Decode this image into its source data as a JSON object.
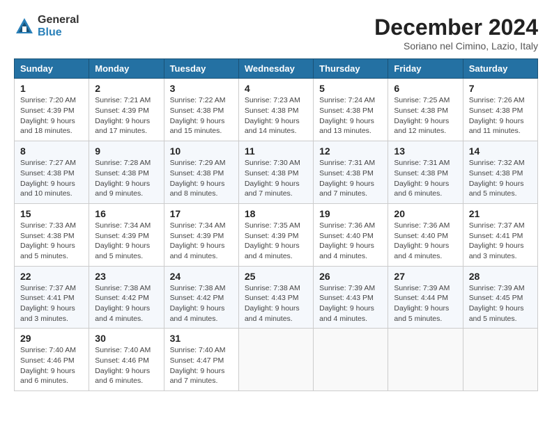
{
  "logo": {
    "general": "General",
    "blue": "Blue"
  },
  "title": "December 2024",
  "subtitle": "Soriano nel Cimino, Lazio, Italy",
  "days_of_week": [
    "Sunday",
    "Monday",
    "Tuesday",
    "Wednesday",
    "Thursday",
    "Friday",
    "Saturday"
  ],
  "weeks": [
    [
      {
        "day": "1",
        "sunrise": "7:20 AM",
        "sunset": "4:39 PM",
        "daylight": "9 hours and 18 minutes."
      },
      {
        "day": "2",
        "sunrise": "7:21 AM",
        "sunset": "4:39 PM",
        "daylight": "9 hours and 17 minutes."
      },
      {
        "day": "3",
        "sunrise": "7:22 AM",
        "sunset": "4:38 PM",
        "daylight": "9 hours and 15 minutes."
      },
      {
        "day": "4",
        "sunrise": "7:23 AM",
        "sunset": "4:38 PM",
        "daylight": "9 hours and 14 minutes."
      },
      {
        "day": "5",
        "sunrise": "7:24 AM",
        "sunset": "4:38 PM",
        "daylight": "9 hours and 13 minutes."
      },
      {
        "day": "6",
        "sunrise": "7:25 AM",
        "sunset": "4:38 PM",
        "daylight": "9 hours and 12 minutes."
      },
      {
        "day": "7",
        "sunrise": "7:26 AM",
        "sunset": "4:38 PM",
        "daylight": "9 hours and 11 minutes."
      }
    ],
    [
      {
        "day": "8",
        "sunrise": "7:27 AM",
        "sunset": "4:38 PM",
        "daylight": "9 hours and 10 minutes."
      },
      {
        "day": "9",
        "sunrise": "7:28 AM",
        "sunset": "4:38 PM",
        "daylight": "9 hours and 9 minutes."
      },
      {
        "day": "10",
        "sunrise": "7:29 AM",
        "sunset": "4:38 PM",
        "daylight": "9 hours and 8 minutes."
      },
      {
        "day": "11",
        "sunrise": "7:30 AM",
        "sunset": "4:38 PM",
        "daylight": "9 hours and 7 minutes."
      },
      {
        "day": "12",
        "sunrise": "7:31 AM",
        "sunset": "4:38 PM",
        "daylight": "9 hours and 7 minutes."
      },
      {
        "day": "13",
        "sunrise": "7:31 AM",
        "sunset": "4:38 PM",
        "daylight": "9 hours and 6 minutes."
      },
      {
        "day": "14",
        "sunrise": "7:32 AM",
        "sunset": "4:38 PM",
        "daylight": "9 hours and 5 minutes."
      }
    ],
    [
      {
        "day": "15",
        "sunrise": "7:33 AM",
        "sunset": "4:38 PM",
        "daylight": "9 hours and 5 minutes."
      },
      {
        "day": "16",
        "sunrise": "7:34 AM",
        "sunset": "4:39 PM",
        "daylight": "9 hours and 5 minutes."
      },
      {
        "day": "17",
        "sunrise": "7:34 AM",
        "sunset": "4:39 PM",
        "daylight": "9 hours and 4 minutes."
      },
      {
        "day": "18",
        "sunrise": "7:35 AM",
        "sunset": "4:39 PM",
        "daylight": "9 hours and 4 minutes."
      },
      {
        "day": "19",
        "sunrise": "7:36 AM",
        "sunset": "4:40 PM",
        "daylight": "9 hours and 4 minutes."
      },
      {
        "day": "20",
        "sunrise": "7:36 AM",
        "sunset": "4:40 PM",
        "daylight": "9 hours and 4 minutes."
      },
      {
        "day": "21",
        "sunrise": "7:37 AM",
        "sunset": "4:41 PM",
        "daylight": "9 hours and 3 minutes."
      }
    ],
    [
      {
        "day": "22",
        "sunrise": "7:37 AM",
        "sunset": "4:41 PM",
        "daylight": "9 hours and 3 minutes."
      },
      {
        "day": "23",
        "sunrise": "7:38 AM",
        "sunset": "4:42 PM",
        "daylight": "9 hours and 4 minutes."
      },
      {
        "day": "24",
        "sunrise": "7:38 AM",
        "sunset": "4:42 PM",
        "daylight": "9 hours and 4 minutes."
      },
      {
        "day": "25",
        "sunrise": "7:38 AM",
        "sunset": "4:43 PM",
        "daylight": "9 hours and 4 minutes."
      },
      {
        "day": "26",
        "sunrise": "7:39 AM",
        "sunset": "4:43 PM",
        "daylight": "9 hours and 4 minutes."
      },
      {
        "day": "27",
        "sunrise": "7:39 AM",
        "sunset": "4:44 PM",
        "daylight": "9 hours and 5 minutes."
      },
      {
        "day": "28",
        "sunrise": "7:39 AM",
        "sunset": "4:45 PM",
        "daylight": "9 hours and 5 minutes."
      }
    ],
    [
      {
        "day": "29",
        "sunrise": "7:40 AM",
        "sunset": "4:46 PM",
        "daylight": "9 hours and 6 minutes."
      },
      {
        "day": "30",
        "sunrise": "7:40 AM",
        "sunset": "4:46 PM",
        "daylight": "9 hours and 6 minutes."
      },
      {
        "day": "31",
        "sunrise": "7:40 AM",
        "sunset": "4:47 PM",
        "daylight": "9 hours and 7 minutes."
      },
      null,
      null,
      null,
      null
    ]
  ]
}
